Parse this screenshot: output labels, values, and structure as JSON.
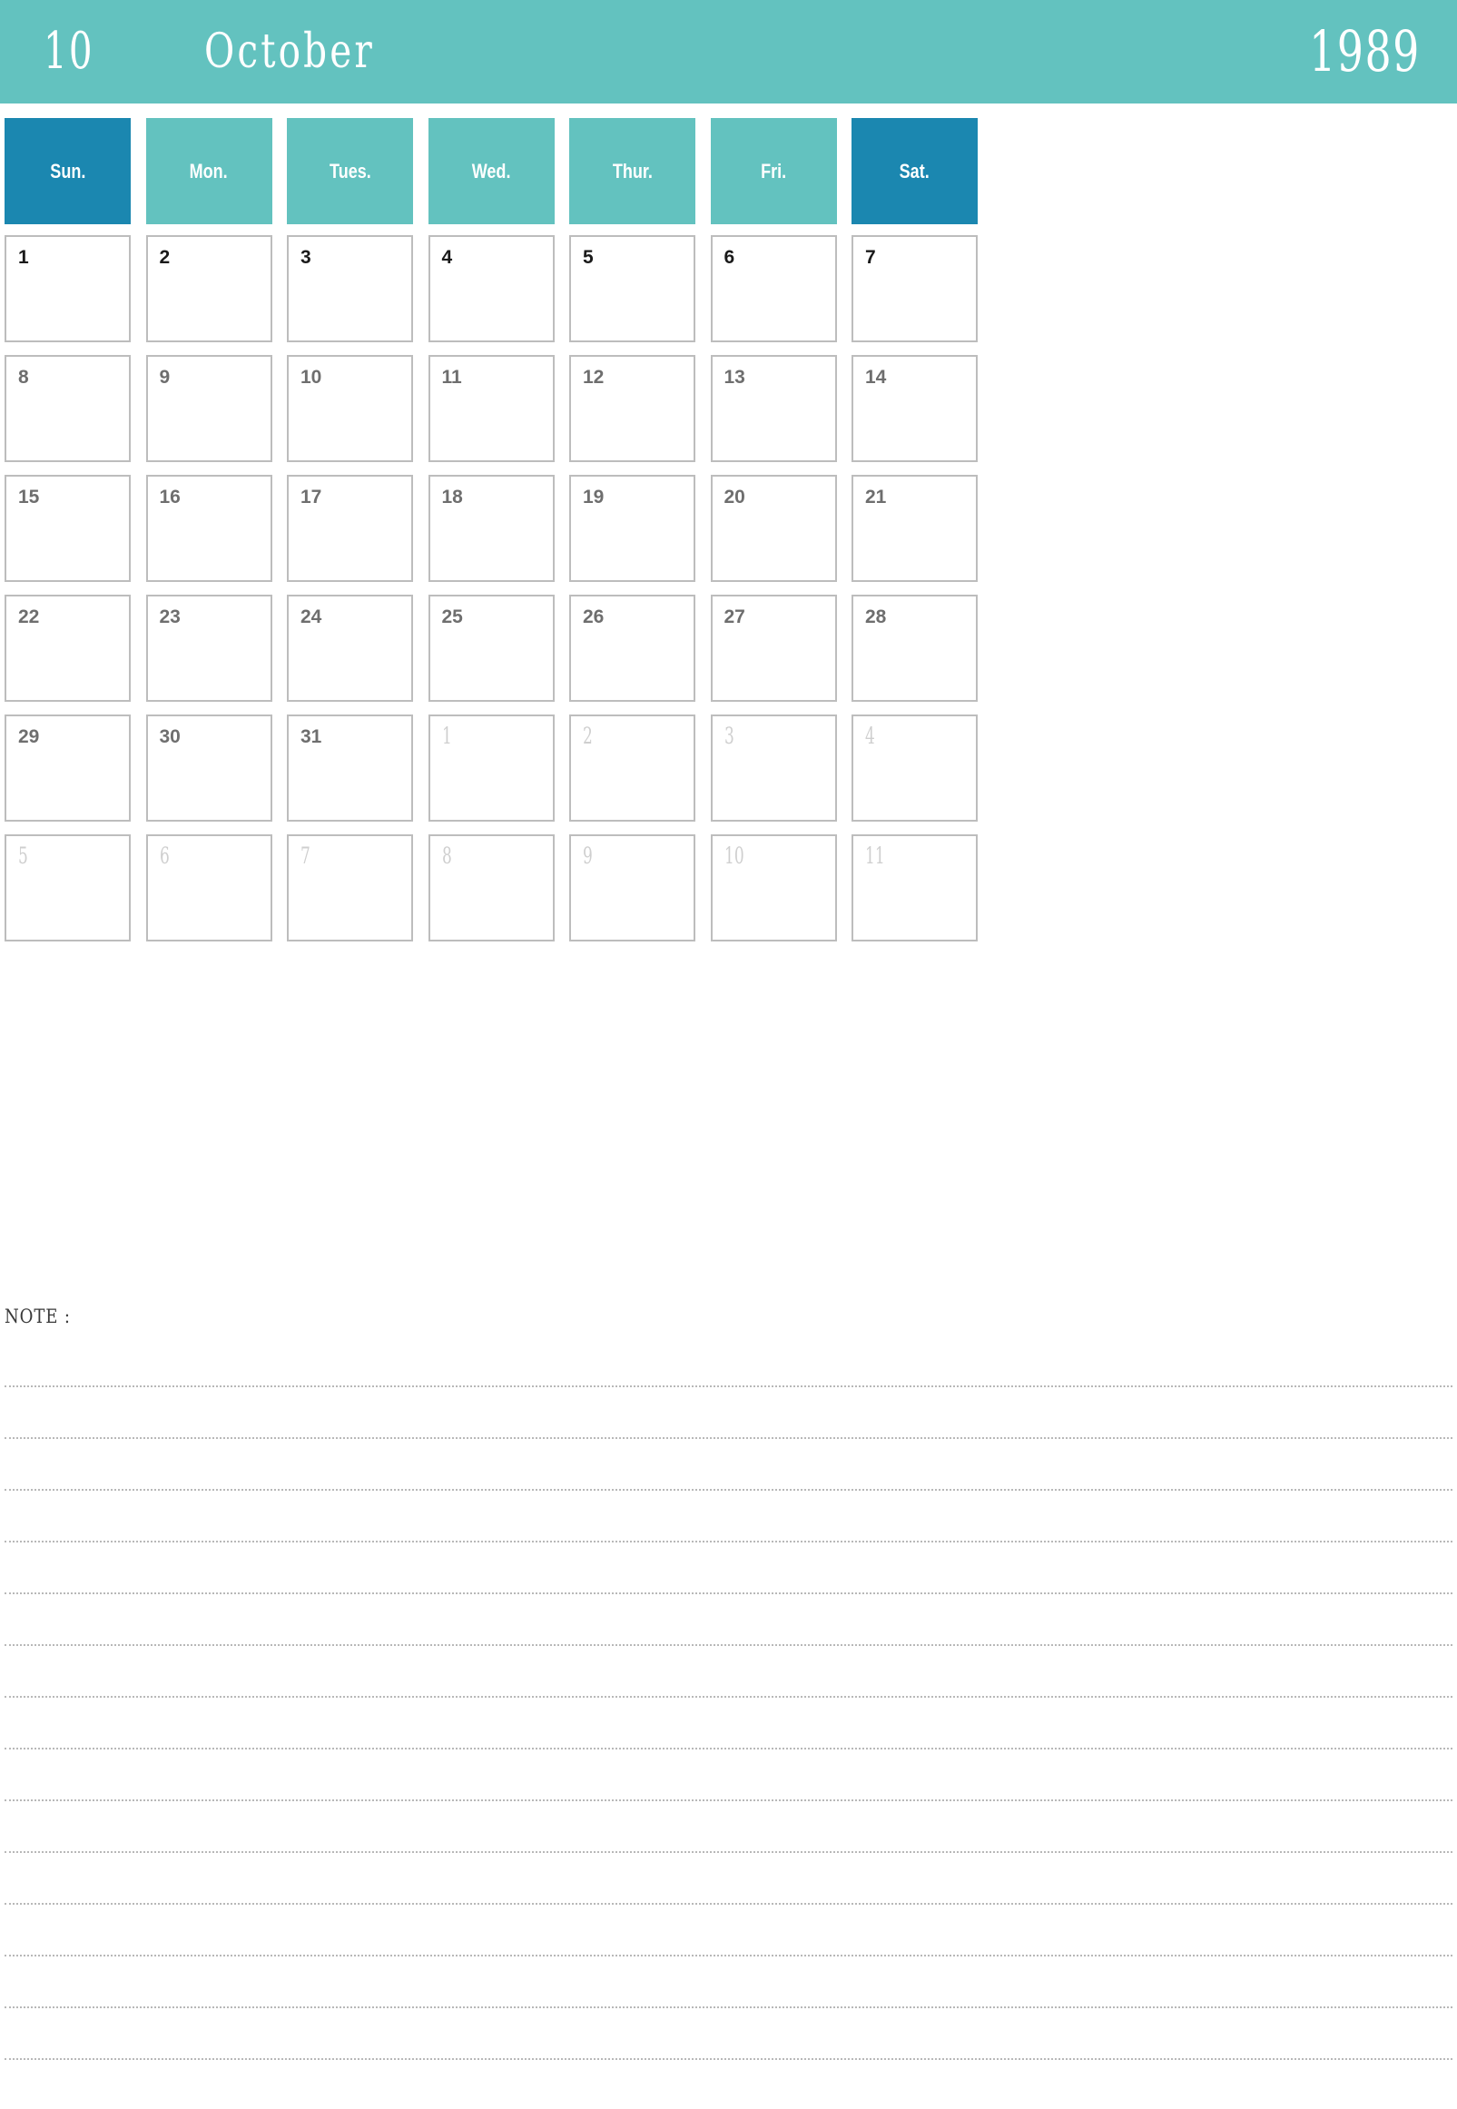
{
  "header": {
    "month_number": "10",
    "month_name": "October",
    "year": "1989",
    "bg_color": "#63c2bf",
    "text_color": "#ffffff"
  },
  "colors": {
    "weekday_bg": "#63c2bf",
    "weekend_bg": "#1b87b0",
    "cell_border": "#bdbdbd",
    "in_month_text": "#6e6e6e",
    "first_week_text": "#1a1a1a",
    "other_month_text": "#cfcfcf",
    "note_rule": "#b8b8b8"
  },
  "weekdays": [
    {
      "label": "Sun.",
      "weekend": true
    },
    {
      "label": "Mon.",
      "weekend": false
    },
    {
      "label": "Tues.",
      "weekend": false
    },
    {
      "label": "Wed.",
      "weekend": false
    },
    {
      "label": "Thur.",
      "weekend": false
    },
    {
      "label": "Fri.",
      "weekend": false
    },
    {
      "label": "Sat.",
      "weekend": true
    }
  ],
  "weeks": [
    [
      {
        "num": "1",
        "in_month": true,
        "first_week": true
      },
      {
        "num": "2",
        "in_month": true,
        "first_week": true
      },
      {
        "num": "3",
        "in_month": true,
        "first_week": true
      },
      {
        "num": "4",
        "in_month": true,
        "first_week": true
      },
      {
        "num": "5",
        "in_month": true,
        "first_week": true
      },
      {
        "num": "6",
        "in_month": true,
        "first_week": true
      },
      {
        "num": "7",
        "in_month": true,
        "first_week": true
      }
    ],
    [
      {
        "num": "8",
        "in_month": true,
        "first_week": false
      },
      {
        "num": "9",
        "in_month": true,
        "first_week": false
      },
      {
        "num": "10",
        "in_month": true,
        "first_week": false
      },
      {
        "num": "11",
        "in_month": true,
        "first_week": false
      },
      {
        "num": "12",
        "in_month": true,
        "first_week": false
      },
      {
        "num": "13",
        "in_month": true,
        "first_week": false
      },
      {
        "num": "14",
        "in_month": true,
        "first_week": false
      }
    ],
    [
      {
        "num": "15",
        "in_month": true,
        "first_week": false
      },
      {
        "num": "16",
        "in_month": true,
        "first_week": false
      },
      {
        "num": "17",
        "in_month": true,
        "first_week": false
      },
      {
        "num": "18",
        "in_month": true,
        "first_week": false
      },
      {
        "num": "19",
        "in_month": true,
        "first_week": false
      },
      {
        "num": "20",
        "in_month": true,
        "first_week": false
      },
      {
        "num": "21",
        "in_month": true,
        "first_week": false
      }
    ],
    [
      {
        "num": "22",
        "in_month": true,
        "first_week": false
      },
      {
        "num": "23",
        "in_month": true,
        "first_week": false
      },
      {
        "num": "24",
        "in_month": true,
        "first_week": false
      },
      {
        "num": "25",
        "in_month": true,
        "first_week": false
      },
      {
        "num": "26",
        "in_month": true,
        "first_week": false
      },
      {
        "num": "27",
        "in_month": true,
        "first_week": false
      },
      {
        "num": "28",
        "in_month": true,
        "first_week": false
      }
    ],
    [
      {
        "num": "29",
        "in_month": true,
        "first_week": false
      },
      {
        "num": "30",
        "in_month": true,
        "first_week": false
      },
      {
        "num": "31",
        "in_month": true,
        "first_week": false
      },
      {
        "num": "1",
        "in_month": false,
        "first_week": false
      },
      {
        "num": "2",
        "in_month": false,
        "first_week": false
      },
      {
        "num": "3",
        "in_month": false,
        "first_week": false
      },
      {
        "num": "4",
        "in_month": false,
        "first_week": false
      }
    ],
    [
      {
        "num": "5",
        "in_month": false,
        "first_week": false
      },
      {
        "num": "6",
        "in_month": false,
        "first_week": false
      },
      {
        "num": "7",
        "in_month": false,
        "first_week": false
      },
      {
        "num": "8",
        "in_month": false,
        "first_week": false
      },
      {
        "num": "9",
        "in_month": false,
        "first_week": false
      },
      {
        "num": "10",
        "in_month": false,
        "first_week": false
      },
      {
        "num": "11",
        "in_month": false,
        "first_week": false
      }
    ]
  ],
  "note": {
    "label": "NOTE :",
    "line_count": 15
  }
}
